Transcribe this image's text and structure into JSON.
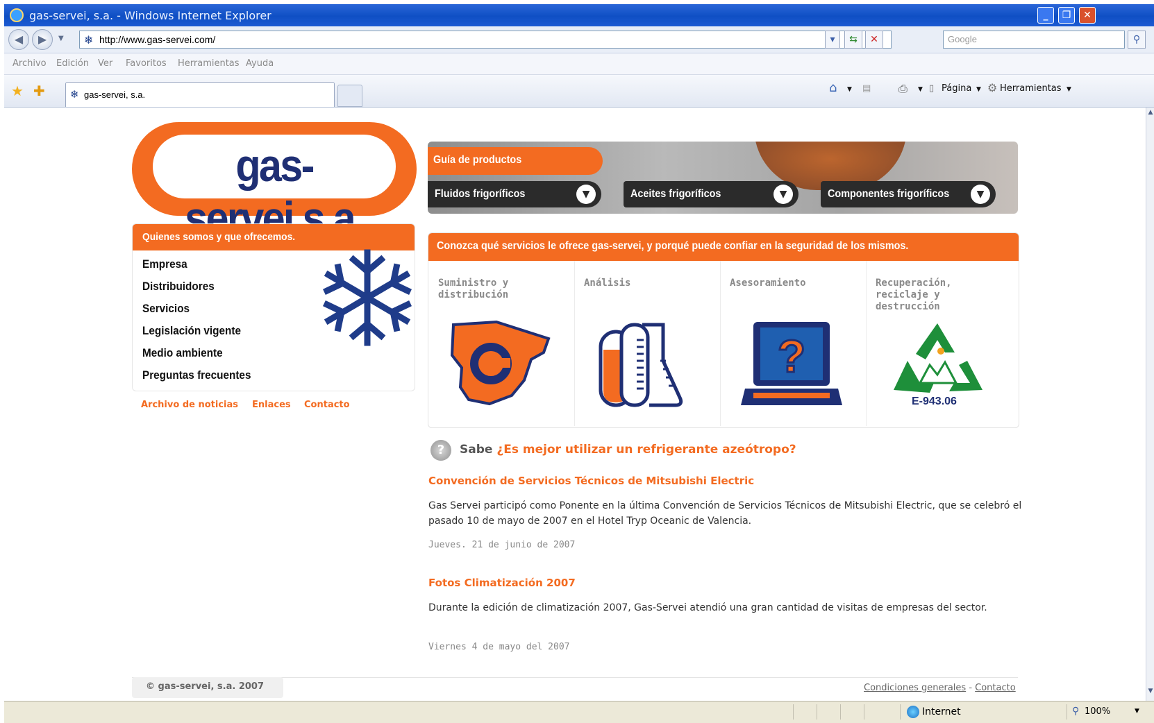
{
  "window": {
    "title": "gas-servei, s.a. - Windows Internet Explorer",
    "minimize": "_",
    "restore": "❐",
    "close": "✕"
  },
  "address_bar": {
    "url": "http://www.gas-servei.com/",
    "search_placeholder": "Google"
  },
  "menu": [
    "Archivo",
    "Edición",
    "Ver",
    "Favoritos",
    "Herramientas",
    "Ayuda"
  ],
  "tab": {
    "label": "gas-servei, s.a."
  },
  "commands": {
    "page": "Página",
    "tools": "Herramientas"
  },
  "logo": {
    "text": "gas-servei,s.a."
  },
  "left_menu": {
    "header": "Quienes somos y que ofrecemos.",
    "items": [
      "Empresa",
      "Distribuidores",
      "Servicios",
      "Legislación vigente",
      "Medio ambiente",
      "Preguntas frecuentes"
    ]
  },
  "secondary_links": [
    "Archivo de noticias",
    "Enlaces",
    "Contacto"
  ],
  "product_guide": {
    "label": "Guía de productos",
    "dropdowns": [
      "Fluidos frigoríficos",
      "Aceites frigoríficos",
      "Componentes frigoríficos"
    ]
  },
  "services": {
    "header": "Conozca qué servicios le ofrece gas-servei, y porqué puede confiar en la seguridad de los mismos.",
    "items": [
      {
        "title": "Suministro y distribución"
      },
      {
        "title": "Análisis"
      },
      {
        "title": "Asesoramiento"
      },
      {
        "title": "Recuperación, reciclaje y destrucción",
        "code": "E-943.06"
      }
    ]
  },
  "sabe": {
    "prefix": "Sabe",
    "link": "¿Es mejor utilizar un refrigerante azeótropo?"
  },
  "news": [
    {
      "title": "Convención de Servicios Técnicos de Mitsubishi Electric",
      "body": "Gas Servei participó como Ponente en la última Convención de Servicios Técnicos de Mitsubishi Electric, que se celebró el pasado 10 de mayo de 2007 en el Hotel Tryp Oceanic de Valencia.",
      "date": "Jueves. 21 de junio de 2007"
    },
    {
      "title": "Fotos Climatización 2007",
      "body": "Durante la edición de climatización 2007, Gas-Servei atendió una gran cantidad de visitas de empresas del sector.",
      "date": "Viernes 4 de mayo del 2007"
    }
  ],
  "footer": {
    "copyright": "© gas-servei, s.a. 2007",
    "terms": "Condiciones generales",
    "separator": "-",
    "contact": "Contacto"
  },
  "status_bar": {
    "zone": "Internet",
    "zoom": "100%"
  },
  "colors": {
    "brand_orange": "#f36b21",
    "brand_navy": "#1f2f74",
    "chrome_blue": "#0f4fc4"
  }
}
